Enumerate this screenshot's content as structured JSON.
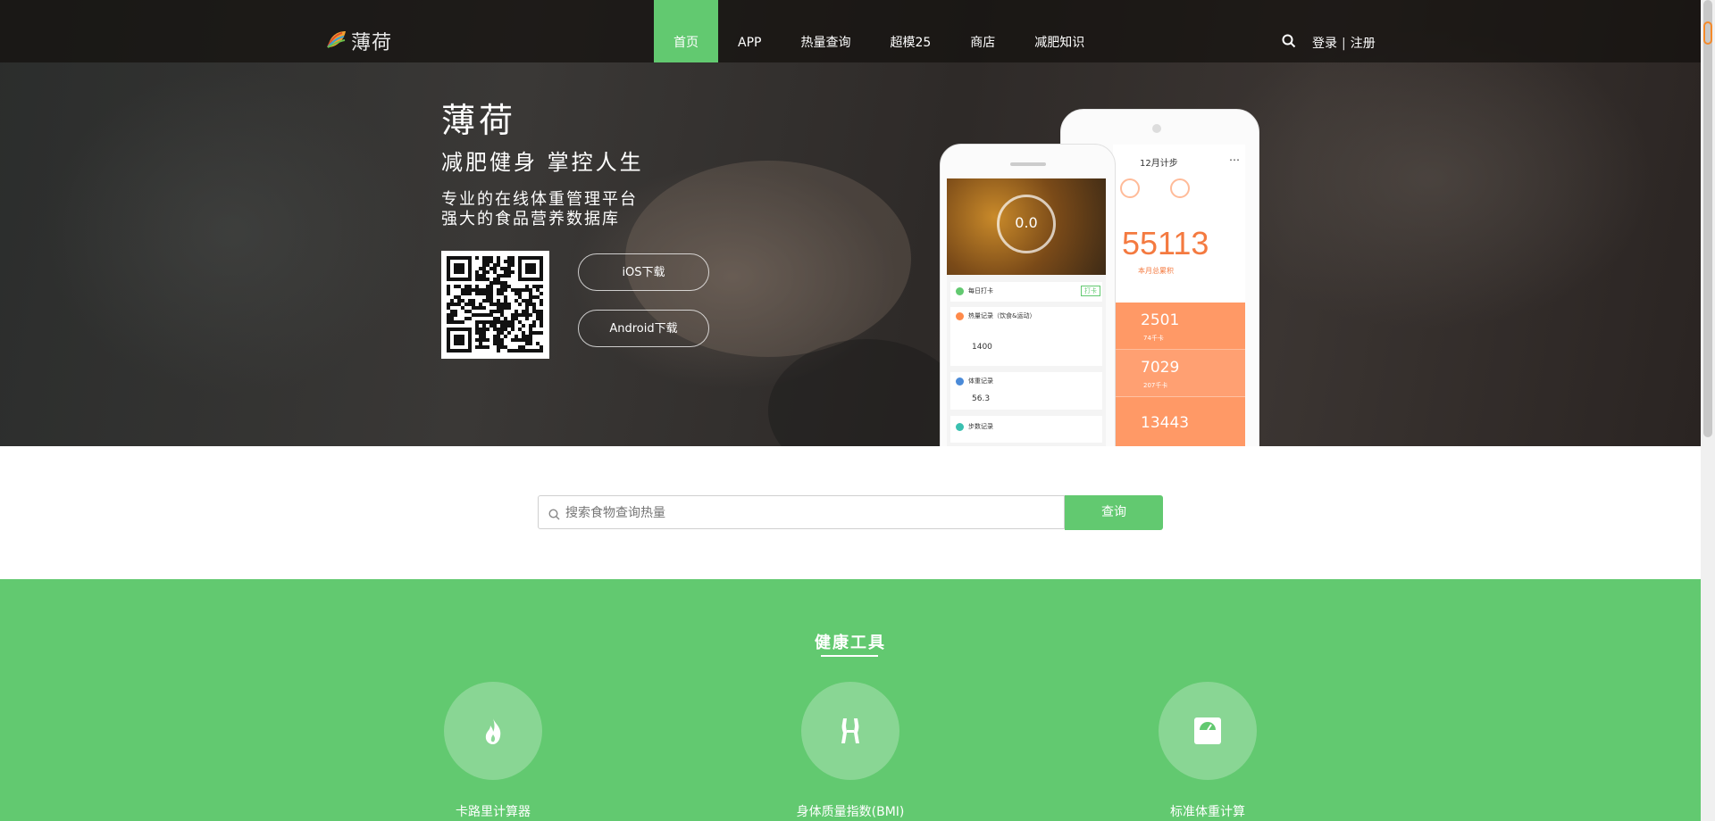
{
  "nav": {
    "logo_text": "薄荷",
    "items": [
      {
        "label": "首页",
        "active": true
      },
      {
        "label": "APP",
        "active": false
      },
      {
        "label": "热量查询",
        "active": false
      },
      {
        "label": "超模25",
        "active": false
      },
      {
        "label": "商店",
        "active": false
      },
      {
        "label": "减肥知识",
        "active": false
      }
    ],
    "login": "登录",
    "separator": "|",
    "register": "注册"
  },
  "hero": {
    "brand": "薄荷",
    "slogan": "减肥健身 掌控人生",
    "desc_line1": "专业的在线体重管理平台",
    "desc_line2": "强大的食品营养数据库",
    "ios_button": "iOS下载",
    "android_button": "Android下载"
  },
  "phone_front": {
    "weight": "0.0",
    "checkin": "每日打卡",
    "checkin_badge": "打卡",
    "calorie_record": "热量记录（饮食&运动）",
    "calorie_value": "1400",
    "weight_record": "体重记录",
    "weight_value": "56.3",
    "step_record": "步数记录"
  },
  "phone_back": {
    "header": "12月计步",
    "total_steps": "55113",
    "total_label": "本月总累积",
    "rows": [
      "2501",
      "7029",
      "13443"
    ],
    "row_subs": [
      "74千卡",
      "207千卡"
    ]
  },
  "search": {
    "placeholder": "搜索食物查询热量",
    "button": "查询"
  },
  "tools": {
    "title": "健康工具",
    "items": [
      {
        "label": "卡路里计算器",
        "icon": "flame-icon"
      },
      {
        "label": "身体质量指数(BMI)",
        "icon": "body-icon"
      },
      {
        "label": "标准体重计算",
        "icon": "scale-icon"
      }
    ]
  },
  "colors": {
    "accent_green": "#62c970",
    "orange": "#ff9966"
  }
}
